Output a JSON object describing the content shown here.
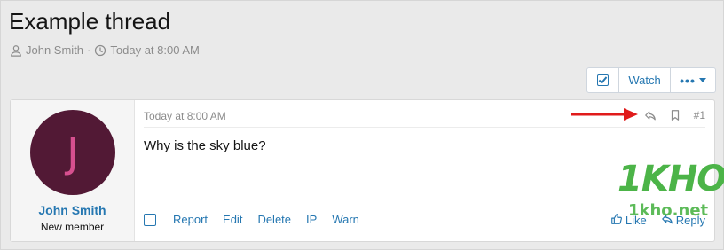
{
  "thread": {
    "title": "Example thread",
    "author": "John Smith",
    "separator": "·",
    "date": "Today at 8:00 AM"
  },
  "toolbar": {
    "watch_label": "Watch",
    "more_label": "•••"
  },
  "post": {
    "author": {
      "avatar_letter": "J",
      "name": "John Smith",
      "title": "New member"
    },
    "date": "Today at 8:00 AM",
    "number": "#1",
    "body": "Why is the sky blue?",
    "actions": [
      "Report",
      "Edit",
      "Delete",
      "IP",
      "Warn"
    ],
    "like_label": "Like",
    "reply_label": "Reply"
  },
  "watermark": {
    "logo": "1KHO",
    "url": "1kho.net"
  },
  "colors": {
    "link": "#2577b1",
    "avatar_bg": "#521935",
    "avatar_letter": "#d6508f",
    "arrow": "#e01b1b",
    "watermark": "#4cb448"
  }
}
